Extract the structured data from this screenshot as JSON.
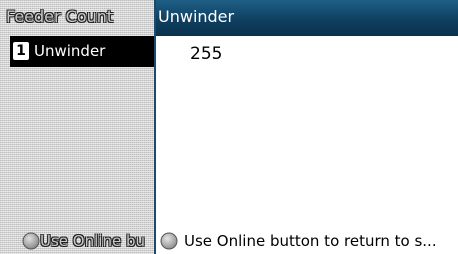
{
  "colors": {
    "header_bg": "#0f3f60",
    "header_text": "#ffffff",
    "left_bg": "#d2d2d2",
    "selected_item_bg": "#000000",
    "indicator_circle": "#9a9a9a"
  },
  "background_panel": {
    "title": "Feeder Count",
    "items": [
      {
        "index": "1",
        "label": "Unwinder"
      }
    ],
    "footer_text": "Use Online bu"
  },
  "dialog": {
    "title": "Unwinder",
    "value": "255",
    "footer_text": "Use Online button to return to s...",
    "footer_icon": "online-indicator-icon"
  }
}
